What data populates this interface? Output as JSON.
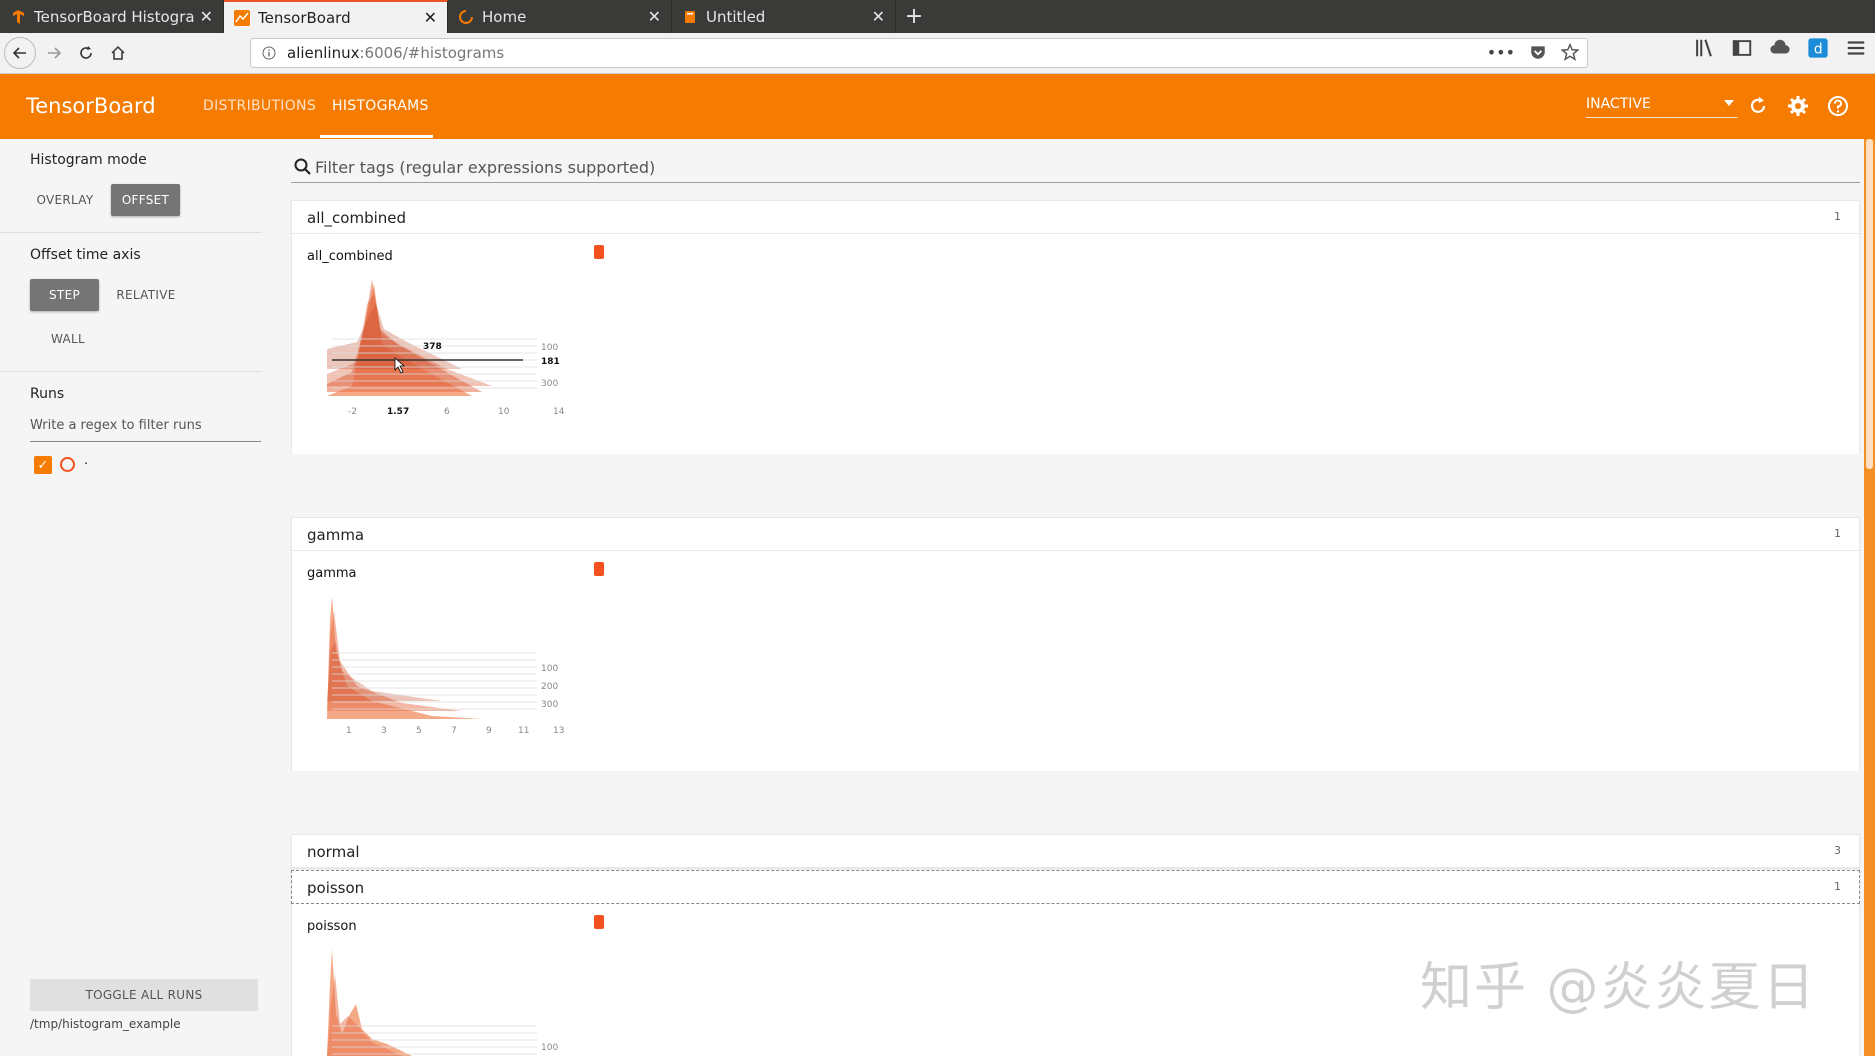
{
  "browser": {
    "tabs": [
      {
        "title": "TensorBoard Histogram",
        "favicon": "tensorflow-icon"
      },
      {
        "title": "TensorBoard",
        "favicon": "tensorboard-icon"
      },
      {
        "title": "Home",
        "favicon": "loading-spinner-icon"
      },
      {
        "title": "Untitled",
        "favicon": "notebook-icon"
      }
    ],
    "active_tab_index": 1,
    "url_host": "alienlinux",
    "url_path": ":6006/#histograms"
  },
  "header": {
    "title": "TensorBoard",
    "tabs": [
      "DISTRIBUTIONS",
      "HISTOGRAMS"
    ],
    "active_tab": "HISTOGRAMS",
    "run_selector": "INACTIVE",
    "accent_color": "#f57c00"
  },
  "sidebar": {
    "histogram_mode_label": "Histogram mode",
    "histogram_modes": [
      "OVERLAY",
      "OFFSET"
    ],
    "histogram_mode_selected": "OFFSET",
    "time_axis_label": "Offset time axis",
    "time_axis_options": [
      "STEP",
      "RELATIVE",
      "WALL"
    ],
    "time_axis_selected": "STEP",
    "runs_label": "Runs",
    "runs_filter_placeholder": "Write a regex to filter runs",
    "runs": [
      {
        "name": ".",
        "checked": true,
        "color": "#f4511e"
      }
    ],
    "toggle_all_label": "TOGGLE ALL RUNS",
    "logdir": "/tmp/histogram_example"
  },
  "main": {
    "filter_placeholder": "Filter tags (regular expressions supported)",
    "categories": [
      {
        "name": "all_combined",
        "count": "1",
        "expanded": true
      },
      {
        "name": "gamma",
        "count": "1",
        "expanded": true
      },
      {
        "name": "normal",
        "count": "3",
        "expanded": false
      },
      {
        "name": "poisson",
        "count": "1",
        "expanded": true
      }
    ],
    "cards": {
      "all_combined": {
        "title": "all_combined",
        "x_ticks": [
          "-2",
          "1.57",
          "6",
          "10",
          "14"
        ],
        "y_ticks": [
          "100",
          "181",
          "300"
        ],
        "hover_x": "1.57",
        "hover_step": "181",
        "hover_count": "378"
      },
      "gamma": {
        "title": "gamma",
        "x_ticks": [
          "1",
          "3",
          "5",
          "7",
          "9",
          "11",
          "13"
        ],
        "y_ticks": [
          "100",
          "200",
          "300"
        ]
      },
      "poisson": {
        "title": "poisson",
        "y_ticks": [
          "100"
        ]
      }
    }
  },
  "watermark": "知乎 @炎炎夏日"
}
